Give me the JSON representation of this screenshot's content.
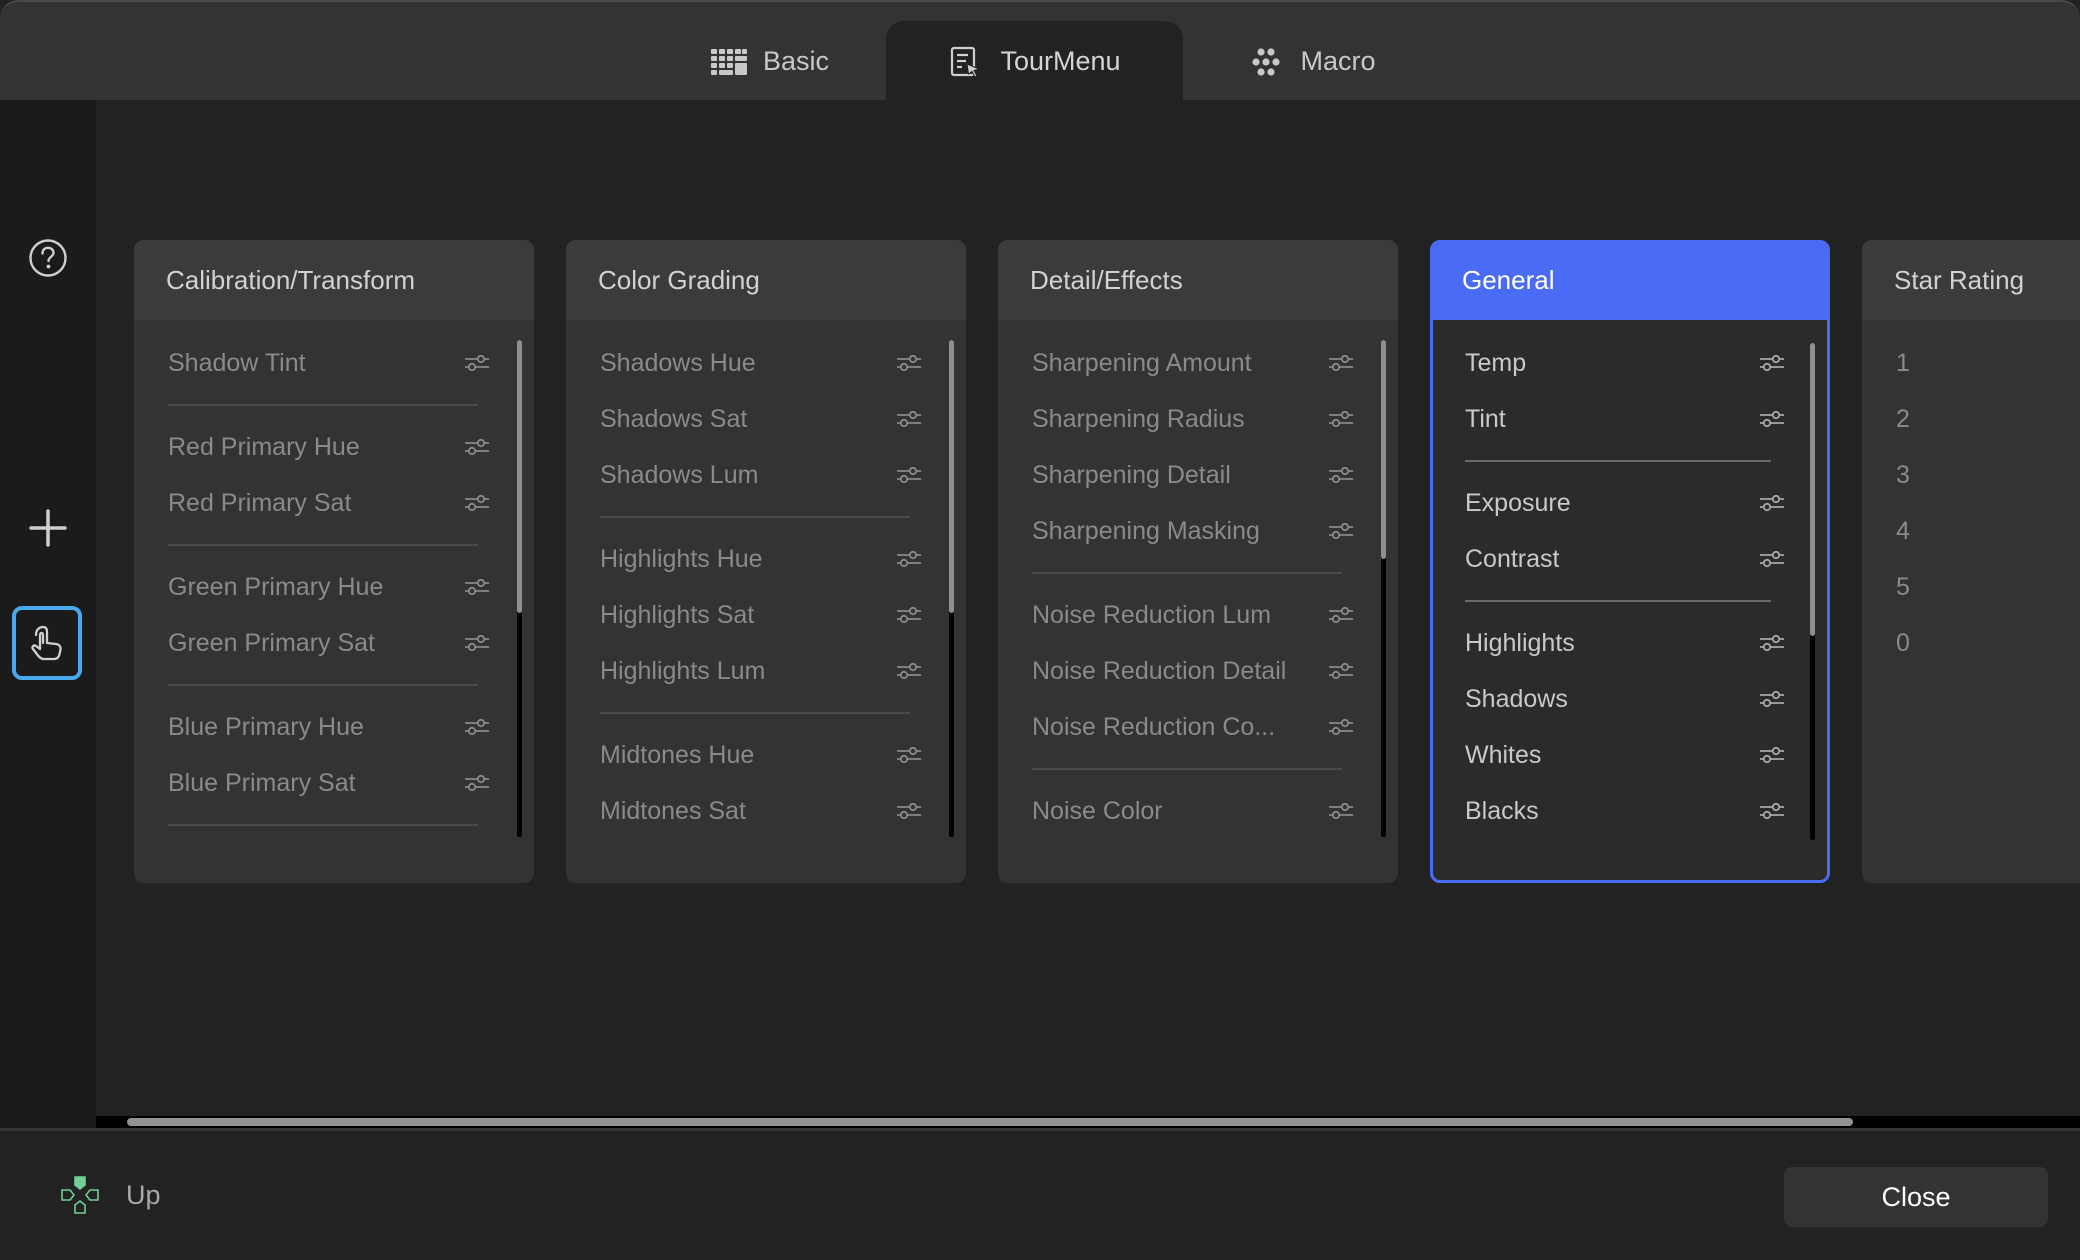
{
  "tabs": [
    {
      "label": "Basic",
      "icon": "keyboard-grid-icon",
      "active": false
    },
    {
      "label": "TourMenu",
      "icon": "menu-cursor-icon",
      "active": true
    },
    {
      "label": "Macro",
      "icon": "dots-cluster-icon",
      "active": false
    }
  ],
  "sidebar": {
    "help_icon": "question-circle-icon",
    "add_icon": "plus-icon",
    "touch_icon": "hand-pointer-icon",
    "touch_active": true,
    "accent_color": "#4aa8ec"
  },
  "cards": [
    {
      "title": "Calibration/Transform",
      "selected": false,
      "scroll_thumb_fraction": 0.55,
      "groups": [
        [
          "Shadow Tint"
        ],
        [
          "Red Primary Hue",
          "Red Primary Sat"
        ],
        [
          "Green Primary Hue",
          "Green Primary Sat"
        ],
        [
          "Blue Primary Hue",
          "Blue Primary Sat"
        ]
      ],
      "trailing_divider": true
    },
    {
      "title": "Color Grading",
      "selected": false,
      "scroll_thumb_fraction": 0.55,
      "groups": [
        [
          "Shadows Hue",
          "Shadows Sat",
          "Shadows Lum"
        ],
        [
          "Highlights Hue",
          "Highlights Sat",
          "Highlights Lum"
        ],
        [
          "Midtones Hue",
          "Midtones Sat"
        ]
      ],
      "trailing_divider": false
    },
    {
      "title": "Detail/Effects",
      "selected": false,
      "scroll_thumb_fraction": 0.44,
      "groups": [
        [
          "Sharpening Amount",
          "Sharpening Radius",
          "Sharpening Detail",
          "Sharpening Masking"
        ],
        [
          "Noise Reduction Lum",
          "Noise Reduction Detail",
          "Noise Reduction Co..."
        ],
        [
          "Noise Color"
        ]
      ],
      "trailing_divider": false
    },
    {
      "title": "General",
      "selected": true,
      "scroll_thumb_fraction": 0.59,
      "groups": [
        [
          "Temp",
          "Tint"
        ],
        [
          "Exposure",
          "Contrast"
        ],
        [
          "Highlights",
          "Shadows",
          "Whites",
          "Blacks"
        ]
      ],
      "trailing_divider": false
    },
    {
      "title": "Star Rating",
      "selected": false,
      "no_icons": true,
      "groups": [
        [
          "1",
          "2",
          "3",
          "4",
          "5",
          "0"
        ]
      ],
      "trailing_divider": false
    }
  ],
  "selected_color": "#4a6cf5",
  "hscroll_thumb_fraction": 0.87,
  "footer": {
    "hint_icon": "dpad-up-icon",
    "hint_icon_color": "#6fcf97",
    "hint_label": "Up",
    "close_label": "Close"
  }
}
